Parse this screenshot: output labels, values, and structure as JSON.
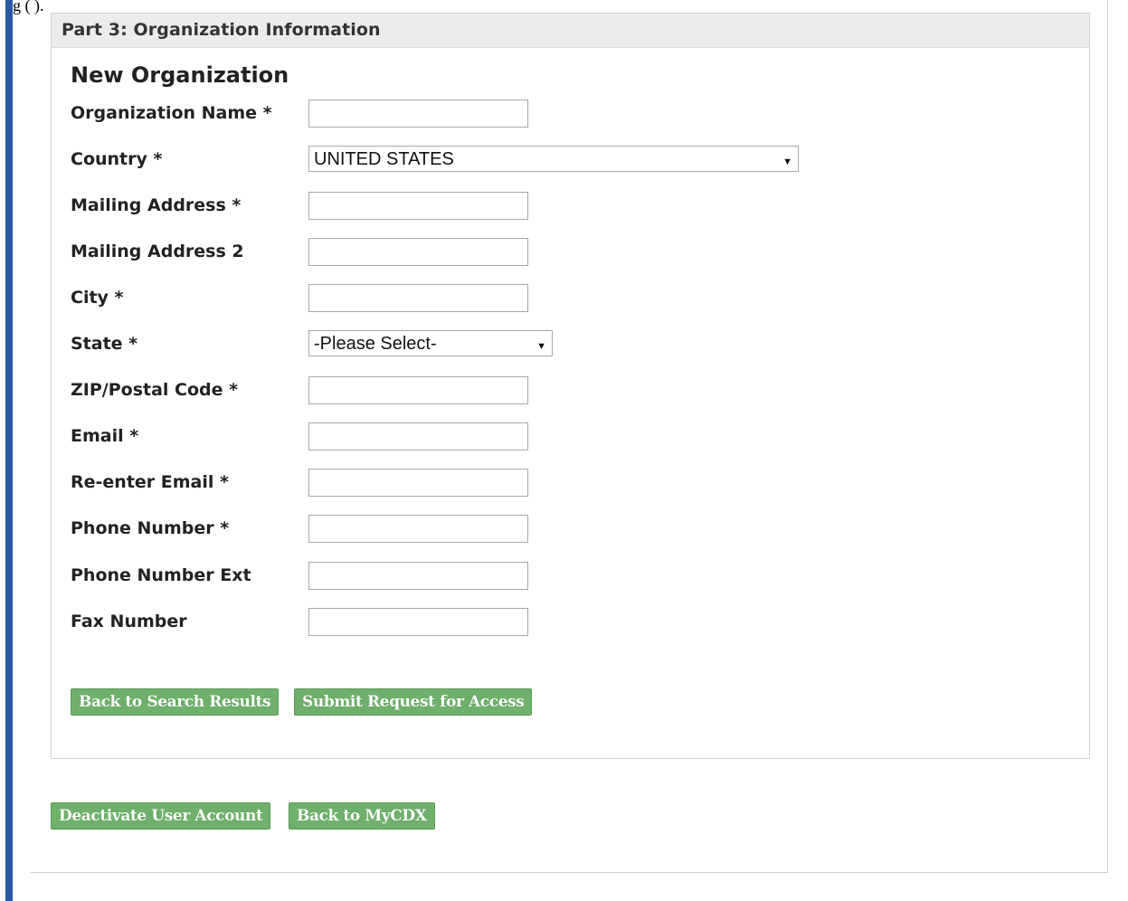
{
  "top_cut_text": "g                      ( ).",
  "panel": {
    "header": "Part 3: Organization Information",
    "title": "New Organization"
  },
  "form": {
    "organization_name": {
      "label": "Organization Name *",
      "value": ""
    },
    "country": {
      "label": "Country *",
      "selected": "UNITED STATES"
    },
    "mailing_address": {
      "label": "Mailing Address *",
      "value": ""
    },
    "mailing_address_2": {
      "label": "Mailing Address 2",
      "value": ""
    },
    "city": {
      "label": "City *",
      "value": ""
    },
    "state": {
      "label": "State *",
      "selected": "-Please Select-"
    },
    "zip": {
      "label": "ZIP/Postal Code *",
      "value": ""
    },
    "email": {
      "label": "Email *",
      "value": ""
    },
    "reenter_email": {
      "label": "Re-enter Email *",
      "value": ""
    },
    "phone": {
      "label": "Phone Number *",
      "value": ""
    },
    "phone_ext": {
      "label": "Phone Number Ext",
      "value": ""
    },
    "fax": {
      "label": "Fax Number",
      "value": ""
    }
  },
  "buttons": {
    "back_to_search": "Back to Search Results",
    "submit_request": "Submit Request for Access",
    "deactivate": "Deactivate User Account",
    "back_to_mycdx": "Back to MyCDX"
  },
  "icons": {
    "dropdown_arrow": "▼"
  },
  "colors": {
    "button_green": "#6fb06c",
    "left_bar_blue": "#2a58a8"
  }
}
